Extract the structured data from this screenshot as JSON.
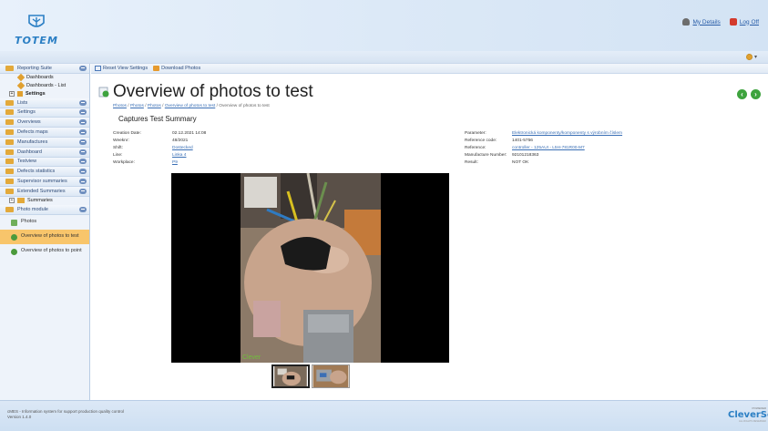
{
  "header": {
    "logo_text": "TOTEM",
    "links": [
      {
        "label": "My Details",
        "icon": "user-icon"
      },
      {
        "label": "Log Off",
        "icon": "logoff-icon"
      }
    ],
    "toolbar_icon": "gear-icon"
  },
  "sidebar": {
    "groups_top": [
      {
        "label": "Reporting Suite",
        "expanded": true
      }
    ],
    "reporting_items": [
      {
        "label": "Dashboards"
      },
      {
        "label": "Dashboards - List"
      }
    ],
    "settings_tree": {
      "label": "Settings"
    },
    "groups": [
      {
        "label": "Lists"
      },
      {
        "label": "Settings"
      },
      {
        "label": "Overviews"
      },
      {
        "label": "Defects maps"
      },
      {
        "label": "Manufactures"
      },
      {
        "label": "Dashboard"
      },
      {
        "label": "Testview"
      },
      {
        "label": "Defects statistics"
      },
      {
        "label": "Supervisor summaries"
      },
      {
        "label": "Extended Summaries"
      }
    ],
    "summaries_tree": {
      "label": "Summaries"
    },
    "photo_group": {
      "label": "Photo module"
    },
    "photo_items": [
      {
        "label": "Photos",
        "active": false
      },
      {
        "label": "Overview of photos to test",
        "active": true
      },
      {
        "label": "Overview of photos to point",
        "active": false
      }
    ]
  },
  "toolbar": {
    "reset_label": "Reset View Settings",
    "download_label": "Download Photos"
  },
  "page": {
    "title": "Overview of photos to test",
    "breadcrumb": [
      {
        "label": "Photos",
        "link": true
      },
      {
        "label": "Photos",
        "link": true
      },
      {
        "label": "Photos",
        "link": true
      },
      {
        "label": "Overview of photos to test",
        "link": true
      },
      {
        "label": "Overview of photos to test",
        "link": false
      }
    ],
    "section_title": "Captures Test Summary",
    "details_left": [
      {
        "key": "Creation Date:",
        "value": "02.12.2021 14:08",
        "link": false
      },
      {
        "key": "Weeknr:",
        "value": "48/2021",
        "link": false
      },
      {
        "key": "Shift:",
        "value": "Dostecked",
        "link": true
      },
      {
        "key": "Line:",
        "value": "Linka 4",
        "link": true
      },
      {
        "key": "Workplace:",
        "value": "P9",
        "link": true
      }
    ],
    "details_right": [
      {
        "key": "Parameter:",
        "value": "Elektronická komponenty/komponenty s výrobním číslem",
        "link": true
      },
      {
        "key": "Reference code:",
        "value": "1401-5756",
        "link": false
      },
      {
        "key": "Reference:",
        "value": "controller - 125AUI - L5H-781R00-M7",
        "link": true
      },
      {
        "key": "Manufacture Number:",
        "value": "92101218363",
        "link": false
      },
      {
        "key": "Result:",
        "value": "NOT OK",
        "link": false
      }
    ],
    "photo_watermark": "Clever"
  },
  "footer": {
    "line1": "cMES - Information system for support production quality control",
    "line2": "Version 1.4.0",
    "logo_pre": "POWERED",
    "logo_brand": "CleverSe",
    "logo_post": "ALL RIGHTS RESERVED"
  }
}
